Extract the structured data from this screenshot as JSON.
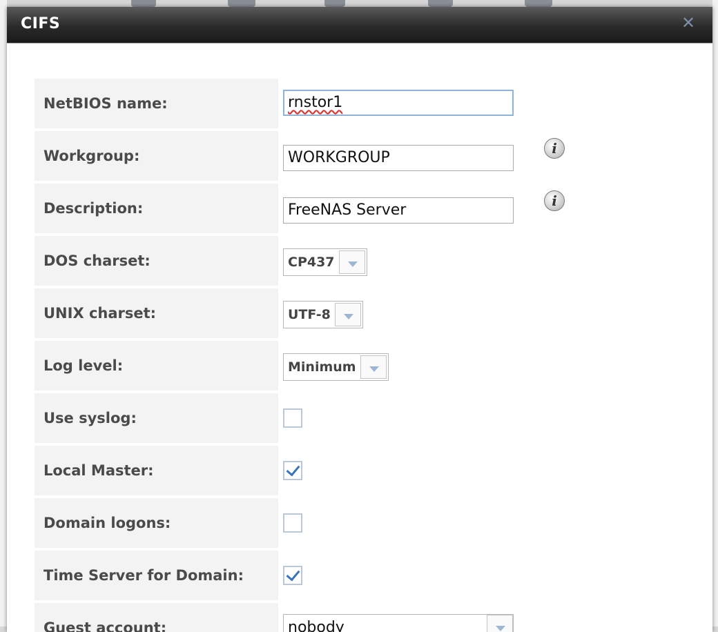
{
  "dialog": {
    "title": "CIFS",
    "close_icon": "close-icon"
  },
  "form": {
    "netbios": {
      "label": "NetBIOS name:",
      "value": "rnstor1"
    },
    "workgroup": {
      "label": "Workgroup:",
      "value": "WORKGROUP",
      "info_icon": "info-icon"
    },
    "description": {
      "label": "Description:",
      "value": "FreeNAS Server",
      "info_icon": "info-icon"
    },
    "dos_charset": {
      "label": "DOS charset:",
      "value": "CP437"
    },
    "unix_charset": {
      "label": "UNIX charset:",
      "value": "UTF-8"
    },
    "log_level": {
      "label": "Log level:",
      "value": "Minimum"
    },
    "use_syslog": {
      "label": "Use syslog:",
      "checked": false
    },
    "local_master": {
      "label": "Local Master:",
      "checked": true
    },
    "domain_logons": {
      "label": "Domain logons:",
      "checked": false
    },
    "time_server": {
      "label": "Time Server for Domain:",
      "checked": true
    },
    "guest_account": {
      "label": "Guest account:",
      "value": "nobody"
    }
  },
  "colors": {
    "titlebar": "#2a2a2a",
    "label_bg": "#f3f3f3",
    "check_accent": "#3a72b8"
  }
}
